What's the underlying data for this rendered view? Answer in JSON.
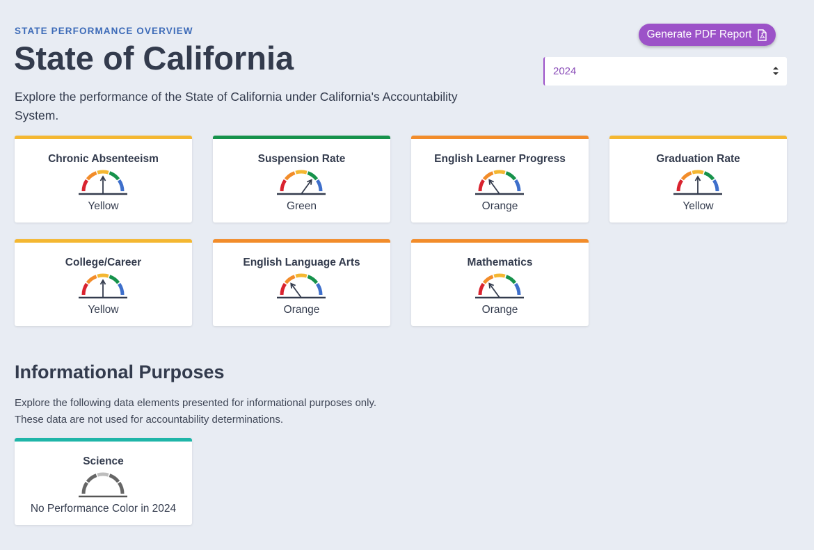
{
  "header": {
    "eyebrow": "STATE PERFORMANCE OVERVIEW",
    "title": "State of California",
    "intro": "Explore the performance of the State of California under California's Accountability System."
  },
  "actions": {
    "pdf_label": "Generate PDF Report",
    "year_selected": "2024"
  },
  "colors": {
    "red": "#d9232f",
    "orange": "#f28c2a",
    "yellow": "#f4b731",
    "green": "#16924b",
    "blue": "#3e6fcb",
    "teal": "#1fb5a8",
    "gray_dark": "#666666",
    "gray_light": "#bdbdbd",
    "accent": "#9c52c8"
  },
  "indicators": [
    {
      "title": "Chronic Absenteeism",
      "status": "Yellow",
      "level": 3
    },
    {
      "title": "Suspension Rate",
      "status": "Green",
      "level": 4
    },
    {
      "title": "English Learner Progress",
      "status": "Orange",
      "level": 2
    },
    {
      "title": "Graduation Rate",
      "status": "Yellow",
      "level": 3
    },
    {
      "title": "College/Career",
      "status": "Yellow",
      "level": 3
    },
    {
      "title": "English Language Arts",
      "status": "Orange",
      "level": 2
    },
    {
      "title": "Mathematics",
      "status": "Orange",
      "level": 2
    }
  ],
  "informational": {
    "title": "Informational Purposes",
    "description": "Explore the following data elements presented for informational purposes only. These data are not used for accountability determinations.",
    "items": [
      {
        "title": "Science",
        "status": "No Performance Color in 2024",
        "level": 0
      }
    ]
  }
}
